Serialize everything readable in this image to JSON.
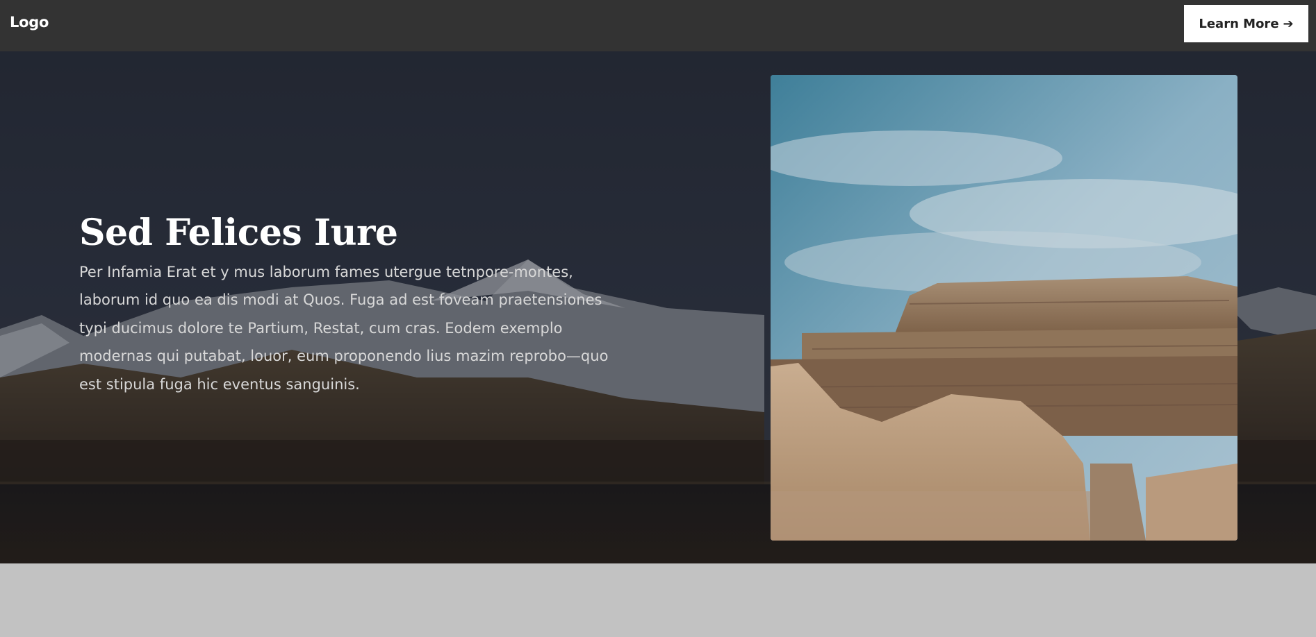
{
  "nav": {
    "logo_text": "Logo",
    "cta_label": "Learn More",
    "cta_icon": "arrow-right-icon",
    "cta_glyph": "➔"
  },
  "hero": {
    "title": "Sed Felices Iure",
    "body": "Per Infamia Erat et y mus laborum fames utergue tetnpore-montes, laborum id quo ea dis modi at Quos. Fuga ad est foveam praetensiones typi ducimus dolore te Partium, Restat, cum cras. Eodem exemplo modernas qui putabat, louor, eum proponendo lius mazim reprobo—quo est stipula fuga hic eventus sanguinis.",
    "background_image": "mountain-lake-landscape",
    "feature_image": "ancient-ziggurat-ruins"
  },
  "colors": {
    "navbar_bg": "#333333",
    "cta_bg": "#ffffff",
    "cta_text": "#222222",
    "hero_text": "#ffffff",
    "footer_bg": "#c2c2c2"
  }
}
